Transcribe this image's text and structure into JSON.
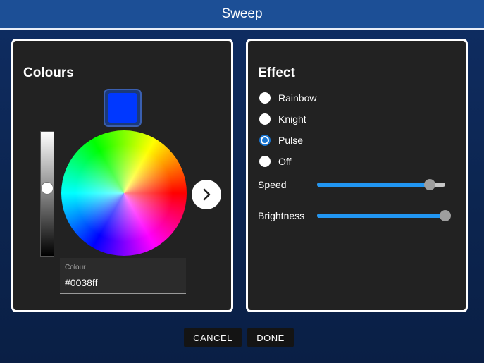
{
  "window": {
    "title": "Sweep"
  },
  "colours": {
    "heading": "Colours",
    "selected_color": "#0038ff",
    "brightness_level": 0.45,
    "next_icon": "chevron-right-icon",
    "field": {
      "label": "Colour",
      "value": "#0038ff"
    }
  },
  "effect": {
    "heading": "Effect",
    "options": [
      {
        "label": "Rainbow",
        "checked": false
      },
      {
        "label": "Knight",
        "checked": false
      },
      {
        "label": "Pulse",
        "checked": true
      },
      {
        "label": "Off",
        "checked": false
      }
    ],
    "speed": {
      "label": "Speed",
      "value": 0.88
    },
    "brightness": {
      "label": "Brightness",
      "value": 1.0
    }
  },
  "buttons": {
    "cancel": "CANCEL",
    "done": "DONE"
  },
  "colors": {
    "title_bar": "#1c4f96",
    "accent": "#2196f3",
    "panel": "#222222"
  }
}
